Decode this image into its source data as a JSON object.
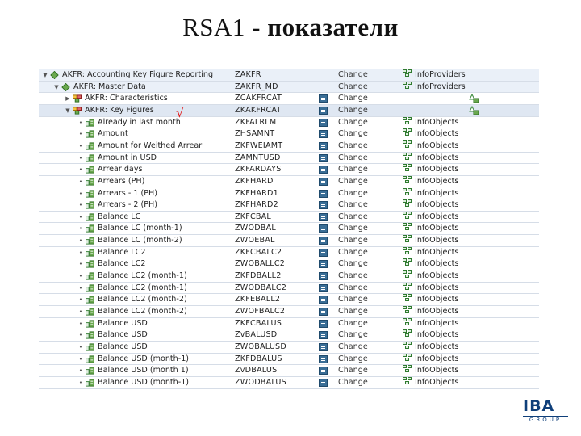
{
  "slide": {
    "title_prefix": "RSA1 - ",
    "title_main": "показатели",
    "check_mark": "√",
    "logo_top": "IBA",
    "logo_bottom": "GROUP"
  },
  "tree": {
    "rows": [
      {
        "name": "AKFR: Accounting Key Figure Reporting",
        "tech": "ZAKFR",
        "status": "Change",
        "object": "InfoProviders",
        "level": 0,
        "arrow": "▼",
        "icon": "diamond",
        "doc": false,
        "warn": false
      },
      {
        "name": "AKFR: Master Data",
        "tech": "ZAKFR_MD",
        "status": "Change",
        "object": "InfoProviders",
        "level": 1,
        "arrow": "▼",
        "icon": "diamond",
        "doc": false,
        "warn": false
      },
      {
        "name": "AKFR: Characteristics",
        "tech": "ZCAKFRCAT",
        "status": "Change",
        "object": "",
        "level": 2,
        "arrow": "▶",
        "icon": "cube",
        "doc": true,
        "warn": true
      },
      {
        "name": "AKFR: Key Figures",
        "tech": "ZKAKFRCAT",
        "status": "Change",
        "object": "",
        "level": 2,
        "arrow": "▼",
        "icon": "cube",
        "doc": true,
        "warn": true
      },
      {
        "name": "Already in last month",
        "tech": "ZKFALRLM",
        "status": "Change",
        "object": "InfoObjects",
        "level": 3,
        "arrow": "•",
        "icon": "kf",
        "doc": true,
        "warn": false
      },
      {
        "name": "Amount",
        "tech": "ZHSAMNT",
        "status": "Change",
        "object": "InfoObjects",
        "level": 3,
        "arrow": "•",
        "icon": "kf",
        "doc": true,
        "warn": false
      },
      {
        "name": "Amount for Weithed Arrear",
        "tech": "ZKFWEIAMT",
        "status": "Change",
        "object": "InfoObjects",
        "level": 3,
        "arrow": "•",
        "icon": "kf",
        "doc": true,
        "warn": false
      },
      {
        "name": "Amount in USD",
        "tech": "ZAMNTUSD",
        "status": "Change",
        "object": "InfoObjects",
        "level": 3,
        "arrow": "•",
        "icon": "kf",
        "doc": true,
        "warn": false
      },
      {
        "name": "Arrear days",
        "tech": "ZKFARDAYS",
        "status": "Change",
        "object": "InfoObjects",
        "level": 3,
        "arrow": "•",
        "icon": "kf",
        "doc": true,
        "warn": false
      },
      {
        "name": "Arrears (PH)",
        "tech": "ZKFHARD",
        "status": "Change",
        "object": "InfoObjects",
        "level": 3,
        "arrow": "•",
        "icon": "kf",
        "doc": true,
        "warn": false
      },
      {
        "name": "Arrears - 1 (PH)",
        "tech": "ZKFHARD1",
        "status": "Change",
        "object": "InfoObjects",
        "level": 3,
        "arrow": "•",
        "icon": "kf",
        "doc": true,
        "warn": false
      },
      {
        "name": "Arrears - 2 (PH)",
        "tech": "ZKFHARD2",
        "status": "Change",
        "object": "InfoObjects",
        "level": 3,
        "arrow": "•",
        "icon": "kf",
        "doc": true,
        "warn": false
      },
      {
        "name": "Balance LC",
        "tech": "ZKFCBAL",
        "status": "Change",
        "object": "InfoObjects",
        "level": 3,
        "arrow": "•",
        "icon": "kf",
        "doc": true,
        "warn": false
      },
      {
        "name": "Balance LC (month-1)",
        "tech": "ZWODBAL",
        "status": "Change",
        "object": "InfoObjects",
        "level": 3,
        "arrow": "•",
        "icon": "kf",
        "doc": true,
        "warn": false
      },
      {
        "name": "Balance LC (month-2)",
        "tech": "ZWOEBAL",
        "status": "Change",
        "object": "InfoObjects",
        "level": 3,
        "arrow": "•",
        "icon": "kf",
        "doc": true,
        "warn": false
      },
      {
        "name": "Balance LC2",
        "tech": "ZKFCBALC2",
        "status": "Change",
        "object": "InfoObjects",
        "level": 3,
        "arrow": "•",
        "icon": "kf",
        "doc": true,
        "warn": false
      },
      {
        "name": "Balance LC2",
        "tech": "ZWOBALLC2",
        "status": "Change",
        "object": "InfoObjects",
        "level": 3,
        "arrow": "•",
        "icon": "kf",
        "doc": true,
        "warn": false
      },
      {
        "name": "Balance LC2 (month-1)",
        "tech": "ZKFDBALL2",
        "status": "Change",
        "object": "InfoObjects",
        "level": 3,
        "arrow": "•",
        "icon": "kf",
        "doc": true,
        "warn": false
      },
      {
        "name": "Balance LC2 (month-1)",
        "tech": "ZWODBALC2",
        "status": "Change",
        "object": "InfoObjects",
        "level": 3,
        "arrow": "•",
        "icon": "kf",
        "doc": true,
        "warn": false
      },
      {
        "name": "Balance LC2 (month-2)",
        "tech": "ZKFEBALL2",
        "status": "Change",
        "object": "InfoObjects",
        "level": 3,
        "arrow": "•",
        "icon": "kf",
        "doc": true,
        "warn": false
      },
      {
        "name": "Balance LC2 (month-2)",
        "tech": "ZWOFBALC2",
        "status": "Change",
        "object": "InfoObjects",
        "level": 3,
        "arrow": "•",
        "icon": "kf",
        "doc": true,
        "warn": false
      },
      {
        "name": "Balance USD",
        "tech": "ZKFCBALUS",
        "status": "Change",
        "object": "InfoObjects",
        "level": 3,
        "arrow": "•",
        "icon": "kf",
        "doc": true,
        "warn": false
      },
      {
        "name": "Balance USD",
        "tech": "ZvBALUSD",
        "status": "Change",
        "object": "InfoObjects",
        "level": 3,
        "arrow": "•",
        "icon": "kf",
        "doc": true,
        "warn": false
      },
      {
        "name": "Balance USD",
        "tech": "ZWOBALUSD",
        "status": "Change",
        "object": "InfoObjects",
        "level": 3,
        "arrow": "•",
        "icon": "kf",
        "doc": true,
        "warn": false
      },
      {
        "name": "Balance USD (month-1)",
        "tech": "ZKFDBALUS",
        "status": "Change",
        "object": "InfoObjects",
        "level": 3,
        "arrow": "•",
        "icon": "kf",
        "doc": true,
        "warn": false
      },
      {
        "name": "Balance USD (month 1)",
        "tech": "ZvDBALUS",
        "status": "Change",
        "object": "InfoObjects",
        "level": 3,
        "arrow": "•",
        "icon": "kf",
        "doc": true,
        "warn": false
      },
      {
        "name": "Balance USD (month-1)",
        "tech": "ZWODBALUS",
        "status": "Change",
        "object": "InfoObjects",
        "level": 3,
        "arrow": "•",
        "icon": "kf",
        "doc": true,
        "warn": false
      }
    ]
  }
}
